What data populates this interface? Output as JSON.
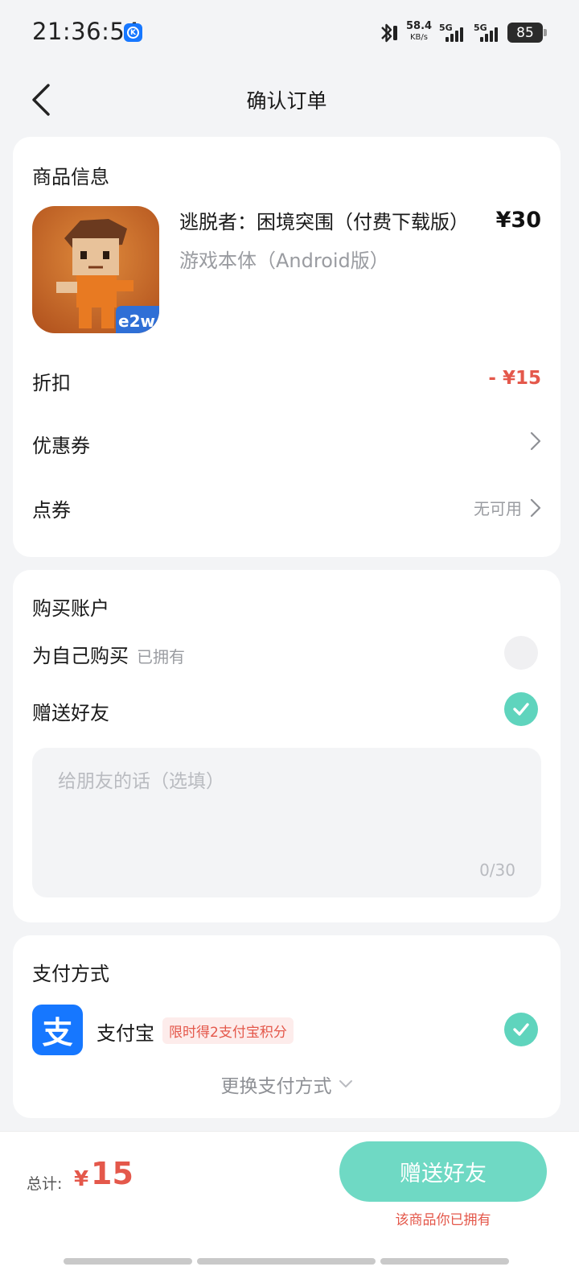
{
  "status": {
    "time": "21:36:54",
    "app_badge": "K",
    "speed_value": "58.4",
    "speed_unit": "KB/s",
    "sim1": "5G",
    "sim2": "5G",
    "battery": "85"
  },
  "header": {
    "title": "确认订单"
  },
  "product": {
    "section_title": "商品信息",
    "name": "逃脱者：困境突围（付费下载版）",
    "subtitle": "游戏本体（Android版）",
    "price": "¥30",
    "icon_text": "e2w",
    "discount_label": "折扣",
    "discount_value": "- ¥15",
    "coupon_label": "优惠券",
    "points_label": "点券",
    "points_value": "无可用"
  },
  "account": {
    "section_title": "购买账户",
    "self_label": "为自己购买",
    "self_note": "已拥有",
    "gift_label": "赠送好友",
    "message_placeholder": "给朋友的话（选填）",
    "message_count": "0/30"
  },
  "payment": {
    "section_title": "支付方式",
    "method_icon": "支",
    "method_name": "支付宝",
    "promo": "限时得2支付宝积分",
    "change_label": "更换支付方式"
  },
  "footer": {
    "total_label": "总计:",
    "currency": "¥",
    "total_value": "15",
    "button_label": "赠送好友",
    "note": "该商品你已拥有"
  },
  "colors": {
    "accent": "#5fd4bd",
    "price_red": "#e4584b",
    "alipay_blue": "#1677ff"
  }
}
